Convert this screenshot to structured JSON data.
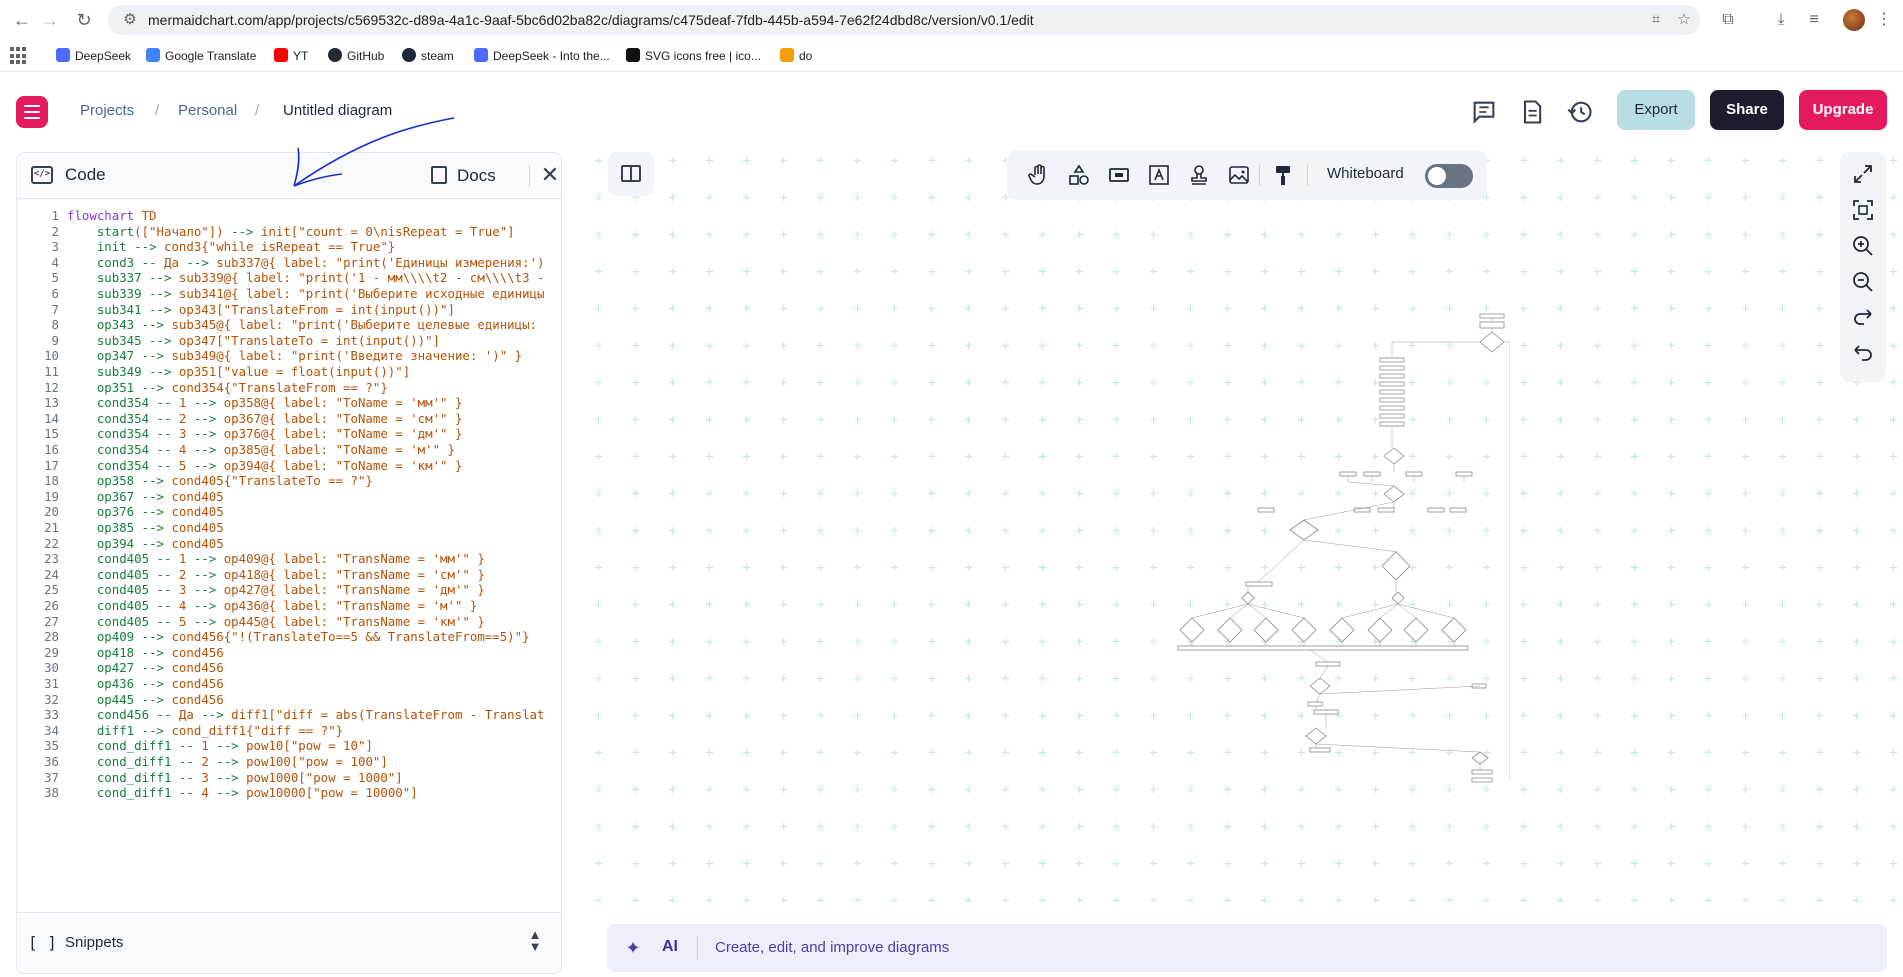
{
  "browser": {
    "url": "mermaidchart.com/app/projects/c569532c-d89a-4a1c-9aaf-5bc6d02ba82c/diagrams/c475deaf-7fdb-445b-a594-7e62f24dbd8c/version/v0.1/edit",
    "bookmarks": [
      "DeepSeek",
      "Google Translate",
      "YT",
      "GitHub",
      "steam",
      "DeepSeek - Into the...",
      "SVG icons free | ico...",
      "do"
    ]
  },
  "header": {
    "breadcrumb": [
      "Projects",
      "Personal",
      "Untitled diagram"
    ],
    "separator": "/",
    "buttons": {
      "export": "Export",
      "share": "Share",
      "upgrade": "Upgrade"
    },
    "colors": {
      "accent": "#e5195f",
      "share_bg": "#1e1b2e",
      "export_bg": "#b9dde4"
    }
  },
  "code_panel": {
    "title": "Code",
    "docs": "Docs",
    "snippets": "Snippets",
    "lines": [
      "flowchart TD",
      "    start([\"Начало\"]) --> init[\"count = 0\\nisRepeat = True\"]",
      "    init --> cond3{\"while isRepeat == True\"}",
      "    cond3 -- Да --> sub337@{ label: \"print('Единицы измерения:')",
      "    sub337 --> sub339@{ label: \"print('1 - мм\\\\\\\\t2 - см\\\\\\\\t3 -",
      "    sub339 --> sub341@{ label: \"print('Выберите исходные единицы",
      "    sub341 --> op343[\"TranslateFrom = int(input())\"]",
      "    op343 --> sub345@{ label: \"print('Выберите целевые единицы:",
      "    sub345 --> op347[\"TranslateTo = int(input())\"]",
      "    op347 --> sub349@{ label: \"print('Введите значение: ')\" }",
      "    sub349 --> op351[\"value = float(input())\"]",
      "    op351 --> cond354{\"TranslateFrom == ?\"}",
      "    cond354 -- 1 --> op358@{ label: \"ToName = 'мм'\" }",
      "    cond354 -- 2 --> op367@{ label: \"ToName = 'см'\" }",
      "    cond354 -- 3 --> op376@{ label: \"ToName = 'дм'\" }",
      "    cond354 -- 4 --> op385@{ label: \"ToName = 'м'\" }",
      "    cond354 -- 5 --> op394@{ label: \"ToName = 'км'\" }",
      "    op358 --> cond405{\"TranslateTo == ?\"}",
      "    op367 --> cond405",
      "    op376 --> cond405",
      "    op385 --> cond405",
      "    op394 --> cond405",
      "    cond405 -- 1 --> op409@{ label: \"TransName = 'мм'\" }",
      "    cond405 -- 2 --> op418@{ label: \"TransName = 'см'\" }",
      "    cond405 -- 3 --> op427@{ label: \"TransName = 'дм'\" }",
      "    cond405 -- 4 --> op436@{ label: \"TransName = 'м'\" }",
      "    cond405 -- 5 --> op445@{ label: \"TransName = 'км'\" }",
      "    op409 --> cond456{\"!(TranslateTo==5 && TranslateFrom==5)\"}",
      "    op418 --> cond456",
      "    op427 --> cond456",
      "    op436 --> cond456",
      "    op445 --> cond456",
      "    cond456 -- Да --> diff1[\"diff = abs(TranslateFrom - Translat",
      "    diff1 --> cond_diff1{\"diff == ?\"}",
      "    cond_diff1 -- 1 --> pow10[\"pow = 10\"]",
      "    cond_diff1 -- 2 --> pow100[\"pow = 100\"]",
      "    cond_diff1 -- 3 --> pow1000[\"pow = 1000\"]",
      "    cond_diff1 -- 4 --> pow10000[\"pow = 10000\"]"
    ]
  },
  "canvas": {
    "whiteboard_label": "Whiteboard",
    "whiteboard_on": false,
    "tools": [
      "hand-icon",
      "shapes-icon",
      "rectangle-icon",
      "text-icon",
      "stamp-icon",
      "image-icon",
      "paint-icon"
    ],
    "right_tools": [
      "expand-icon",
      "fit-icon",
      "zoom-in-icon",
      "zoom-out-icon",
      "redo-icon",
      "undo-icon"
    ]
  },
  "ai_bar": {
    "label": "AI",
    "placeholder": "Create, edit, and improve diagrams"
  }
}
